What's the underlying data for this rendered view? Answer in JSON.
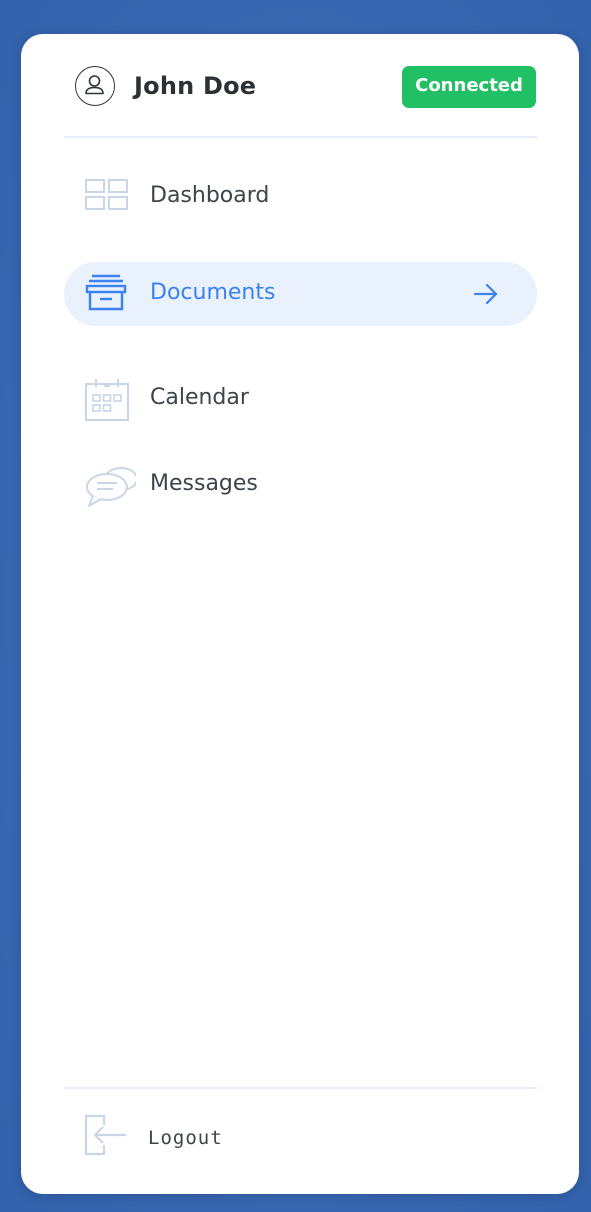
{
  "user": {
    "name": "John Doe",
    "avatar_icon": "user-circle-icon"
  },
  "status": {
    "label": "Connected",
    "color": "#22c065"
  },
  "nav": {
    "items": [
      {
        "label": "Dashboard",
        "icon": "dashboard-grid-icon",
        "active": false
      },
      {
        "label": "Documents",
        "icon": "archive-box-icon",
        "active": true
      },
      {
        "label": "Calendar",
        "icon": "calendar-icon",
        "active": false
      },
      {
        "label": "Messages",
        "icon": "chat-bubbles-icon",
        "active": false
      }
    ],
    "active_arrow_icon": "arrow-right-icon"
  },
  "logout": {
    "label": "Logout",
    "icon": "logout-icon"
  },
  "colors": {
    "background": "#3a6ab3",
    "panel": "#ffffff",
    "accent": "#3b82f0",
    "active_background": "#e9f1fd",
    "icon_muted": "#c7d4e3"
  }
}
